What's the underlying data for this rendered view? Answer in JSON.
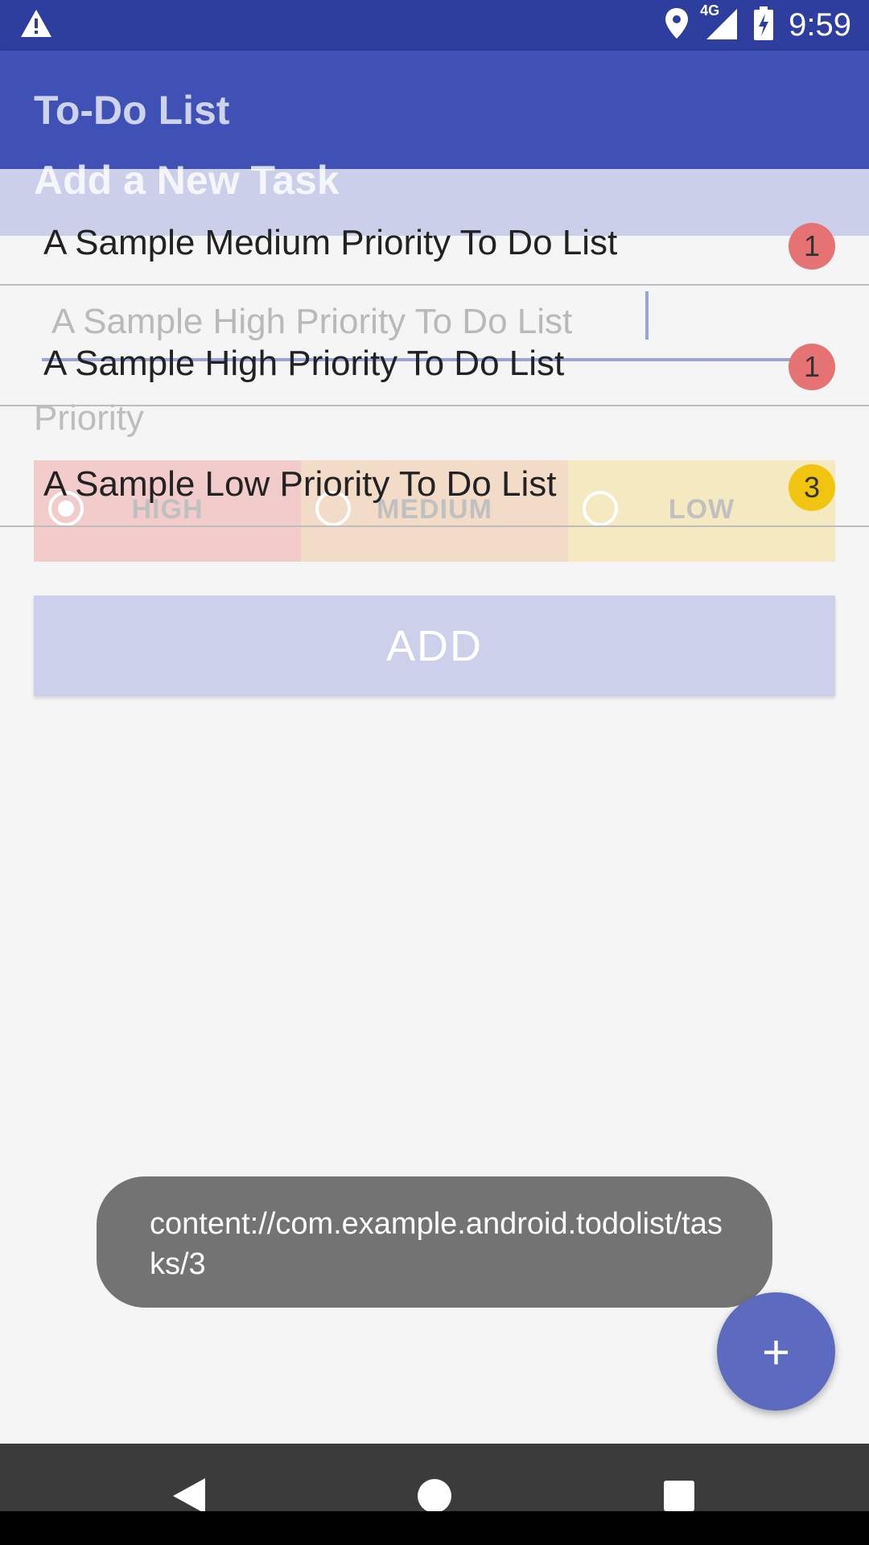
{
  "status_bar": {
    "time": "9:59",
    "network": "4G",
    "icons": [
      "warning-icon",
      "location-icon",
      "signal-icon",
      "battery-charging-icon"
    ]
  },
  "app_bar": {
    "title": "To-Do List"
  },
  "add_task": {
    "title": "Add a New Task",
    "input_value": "A Sample High Priority To Do List",
    "priority_label": "Priority",
    "options": [
      {
        "label": "HIGH",
        "checked": true,
        "color": "#f2cbcb"
      },
      {
        "label": "MEDIUM",
        "checked": false,
        "color": "#f2dcc8"
      },
      {
        "label": "LOW",
        "checked": false,
        "color": "#f4e9c1"
      }
    ],
    "add_button": "ADD"
  },
  "tasks": [
    {
      "text": "A Sample Medium Priority To Do List",
      "priority": "1",
      "color": "#e57373"
    },
    {
      "text": "A Sample High Priority To Do List",
      "priority": "1",
      "color": "#e57373"
    },
    {
      "text": "A Sample Low Priority To Do List",
      "priority": "3",
      "color": "#f1c40f"
    }
  ],
  "toast": {
    "text": "content://com.example.android.todolist/tasks/3"
  },
  "fab": {
    "icon": "plus-icon",
    "label": "+"
  },
  "nav_bar": {
    "icons": [
      "back-icon",
      "home-icon",
      "recents-icon"
    ]
  },
  "colors": {
    "primary": "#3f51b5",
    "primary_dark": "#2d3e9f",
    "fab": "#5c6bc0"
  }
}
